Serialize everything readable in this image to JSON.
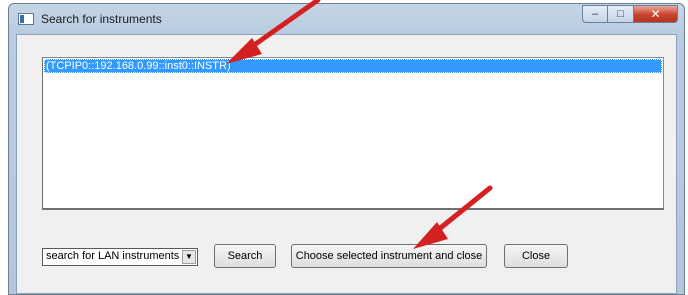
{
  "window": {
    "title": "Search for instruments"
  },
  "caption_buttons": {
    "minimize": "–",
    "maximize": "□",
    "close": "✕"
  },
  "list": {
    "items": [
      "(TCPIP0::192.168.0.99::inst0::INSTR)"
    ]
  },
  "search_mode": {
    "selected": "search for LAN instruments",
    "dropdown_glyph": "▼"
  },
  "buttons": {
    "search": "Search",
    "choose": "Choose selected instrument and close",
    "close": "Close"
  },
  "annotations": {
    "arrow_color": "#d42020"
  }
}
